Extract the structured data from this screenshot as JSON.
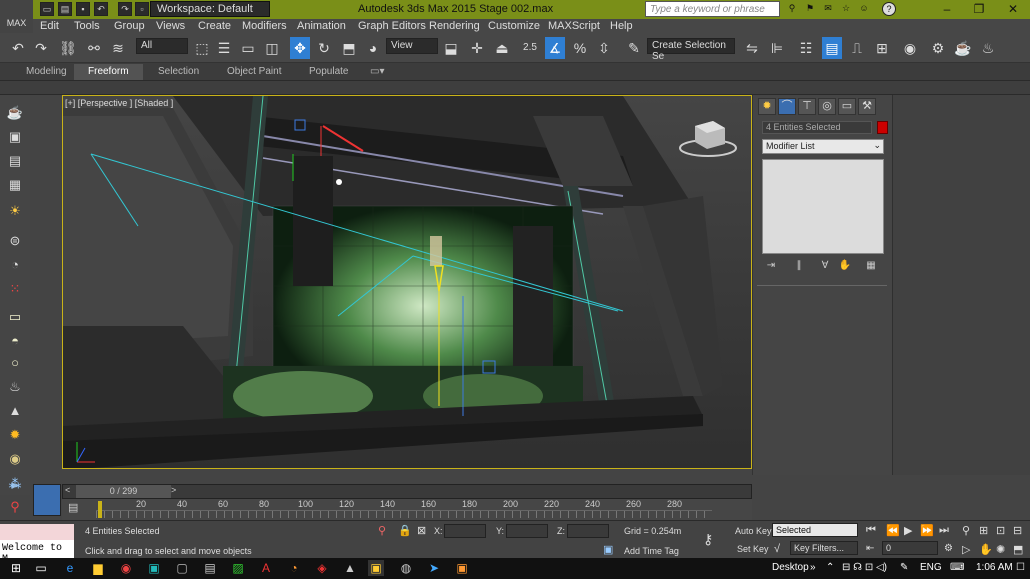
{
  "titlebar": {
    "workspace": "Workspace: Default",
    "title": "Autodesk 3ds Max  2015    Stage 002.max",
    "search_placeholder": "Type a keyword or phrase",
    "logo": "MAX",
    "help": "?"
  },
  "menu": [
    "Edit",
    "Tools",
    "Group",
    "Views",
    "Create",
    "Modifiers",
    "Animation",
    "Graph Editors",
    "Rendering",
    "Customize",
    "MAXScript",
    "Help"
  ],
  "toolbar": {
    "filter": "All",
    "ref_coord": "View",
    "selection_set": "Create Selection Se",
    "snap_label": "2.5"
  },
  "ribbon": {
    "tabs": [
      "Modeling",
      "Freeform",
      "Selection",
      "Object Paint",
      "Populate"
    ],
    "active": "Freeform"
  },
  "viewport": {
    "label": "[+] [Perspective ] [Shaded ]"
  },
  "command_panel": {
    "selection_name": "4 Entities Selected",
    "modifier_list": "Modifier List",
    "selection_color": "#cc0000"
  },
  "timeslider": {
    "frame": "0 / 299",
    "ticks": [
      "20",
      "40",
      "60",
      "80",
      "100",
      "120",
      "140",
      "160",
      "180",
      "200",
      "220",
      "240",
      "260",
      "280"
    ]
  },
  "status": {
    "maxscript_listener": "",
    "maxscript_input": "Welcome to M",
    "selected": "4 Entities Selected",
    "prompt": "Click and drag to select and move objects",
    "x_label": "X:",
    "y_label": "Y:",
    "z_label": "Z:",
    "grid": "Grid = 0.254m",
    "add_time_tag": "Add Time Tag",
    "auto_key": "Auto Key",
    "key_mode": "Selected",
    "set_key": "Set Key",
    "key_filters": "Key Filters...",
    "current_frame": "0"
  },
  "taskbar": {
    "desktop": "Desktop",
    "language": "ENG",
    "time": "1:06 AM"
  }
}
